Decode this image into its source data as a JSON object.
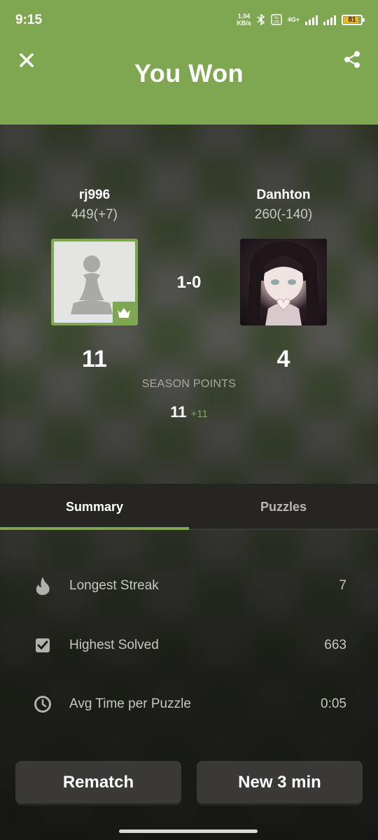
{
  "status_bar": {
    "time": "9:15",
    "net_speed_value": "1.04",
    "net_speed_unit": "KB/s",
    "network_label": "4G+",
    "battery_level": "81"
  },
  "header": {
    "title": "You Won",
    "background_color": "#7fa650"
  },
  "players": [
    {
      "name": "rj996",
      "rating": "449(+7)",
      "points": "11",
      "avatar": "pawn-icon",
      "winner": true
    },
    {
      "name": "Danhton",
      "rating": "260(-140)",
      "points": "4",
      "avatar": "anime-portrait"
    }
  ],
  "result": {
    "score": "1-0"
  },
  "season": {
    "label": "SEASON POINTS",
    "value": "11",
    "delta": "+11"
  },
  "tabs": [
    {
      "label": "Summary",
      "active": true
    },
    {
      "label": "Puzzles",
      "active": false
    }
  ],
  "stats": [
    {
      "icon": "flame-icon",
      "label": "Longest Streak",
      "value": "7"
    },
    {
      "icon": "checkbox-icon",
      "label": "Highest Solved",
      "value": "663"
    },
    {
      "icon": "clock-icon",
      "label": "Avg Time per Puzzle",
      "value": "0:05"
    }
  ],
  "actions": {
    "rematch": "Rematch",
    "new_game": "New 3 min"
  }
}
